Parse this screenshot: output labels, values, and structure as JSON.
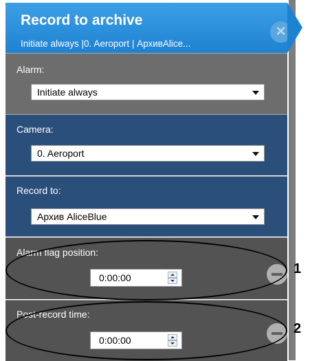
{
  "header": {
    "title": "Record to archive",
    "subtitle": "Initiate always |0. Aeroport | АрхивAlice...",
    "close_glyph": "×"
  },
  "alarm": {
    "label": "Alarm:",
    "value": "Initiate always"
  },
  "camera": {
    "label": "Camera:",
    "value": "0. Aeroport"
  },
  "record_to": {
    "label": "Record to:",
    "value": "Архив AliceBlue"
  },
  "alarm_flag": {
    "label": "Alarm flag position:",
    "value": "0:00:00",
    "callout": "1"
  },
  "post_record": {
    "label": "Post-record time:",
    "value": "0:00:00",
    "callout": "2"
  },
  "colors": {
    "header": "#2a8fdc",
    "camera_bg": "#2b4f7b",
    "gray_bg": "#6d6d6d"
  }
}
